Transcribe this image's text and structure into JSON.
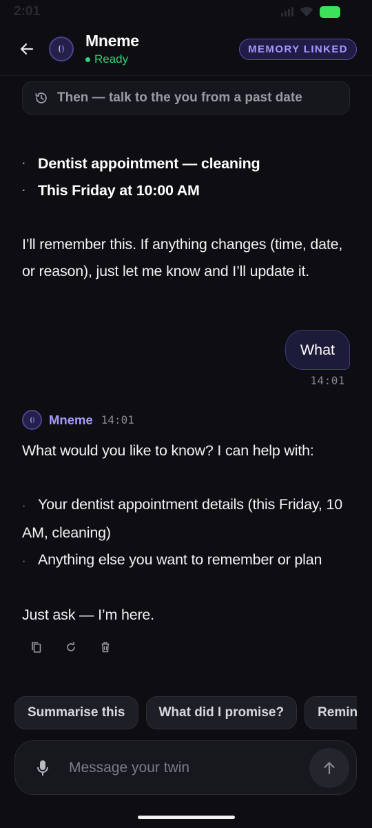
{
  "status_bar": {
    "time": "2:01"
  },
  "header": {
    "title": "Mneme",
    "status": "Ready",
    "badge": "MEMORY LINKED"
  },
  "then_pill": {
    "label": "Then — talk to the you from a past date"
  },
  "prev_message": {
    "bullets": [
      "Dentist appointment — cleaning",
      "This Friday at 10:00 AM"
    ],
    "paragraph": "I’ll remember this. If anything changes (time, date, or reason), just let me know and I’ll update it."
  },
  "user_message": {
    "text": "What",
    "time": "14:01"
  },
  "bot_message": {
    "name": "Mneme",
    "time": "14:01",
    "intro": "What would you like to know? I can help with:",
    "bullets": [
      "Your dentist appointment details (this Friday, 10 AM, cleaning)",
      "Anything else you want to remember or plan"
    ],
    "closing": "Just ask — I’m here."
  },
  "message_actions": {
    "icons": [
      "copy-icon",
      "refresh-icon",
      "trash-icon"
    ]
  },
  "suggestions": [
    "Summarise this",
    "What did I promise?",
    "Remind me"
  ],
  "composer": {
    "placeholder": "Message your twin"
  },
  "colors": {
    "accent": "#a49aff",
    "ready": "#33d17a",
    "background": "#0d0d12"
  }
}
